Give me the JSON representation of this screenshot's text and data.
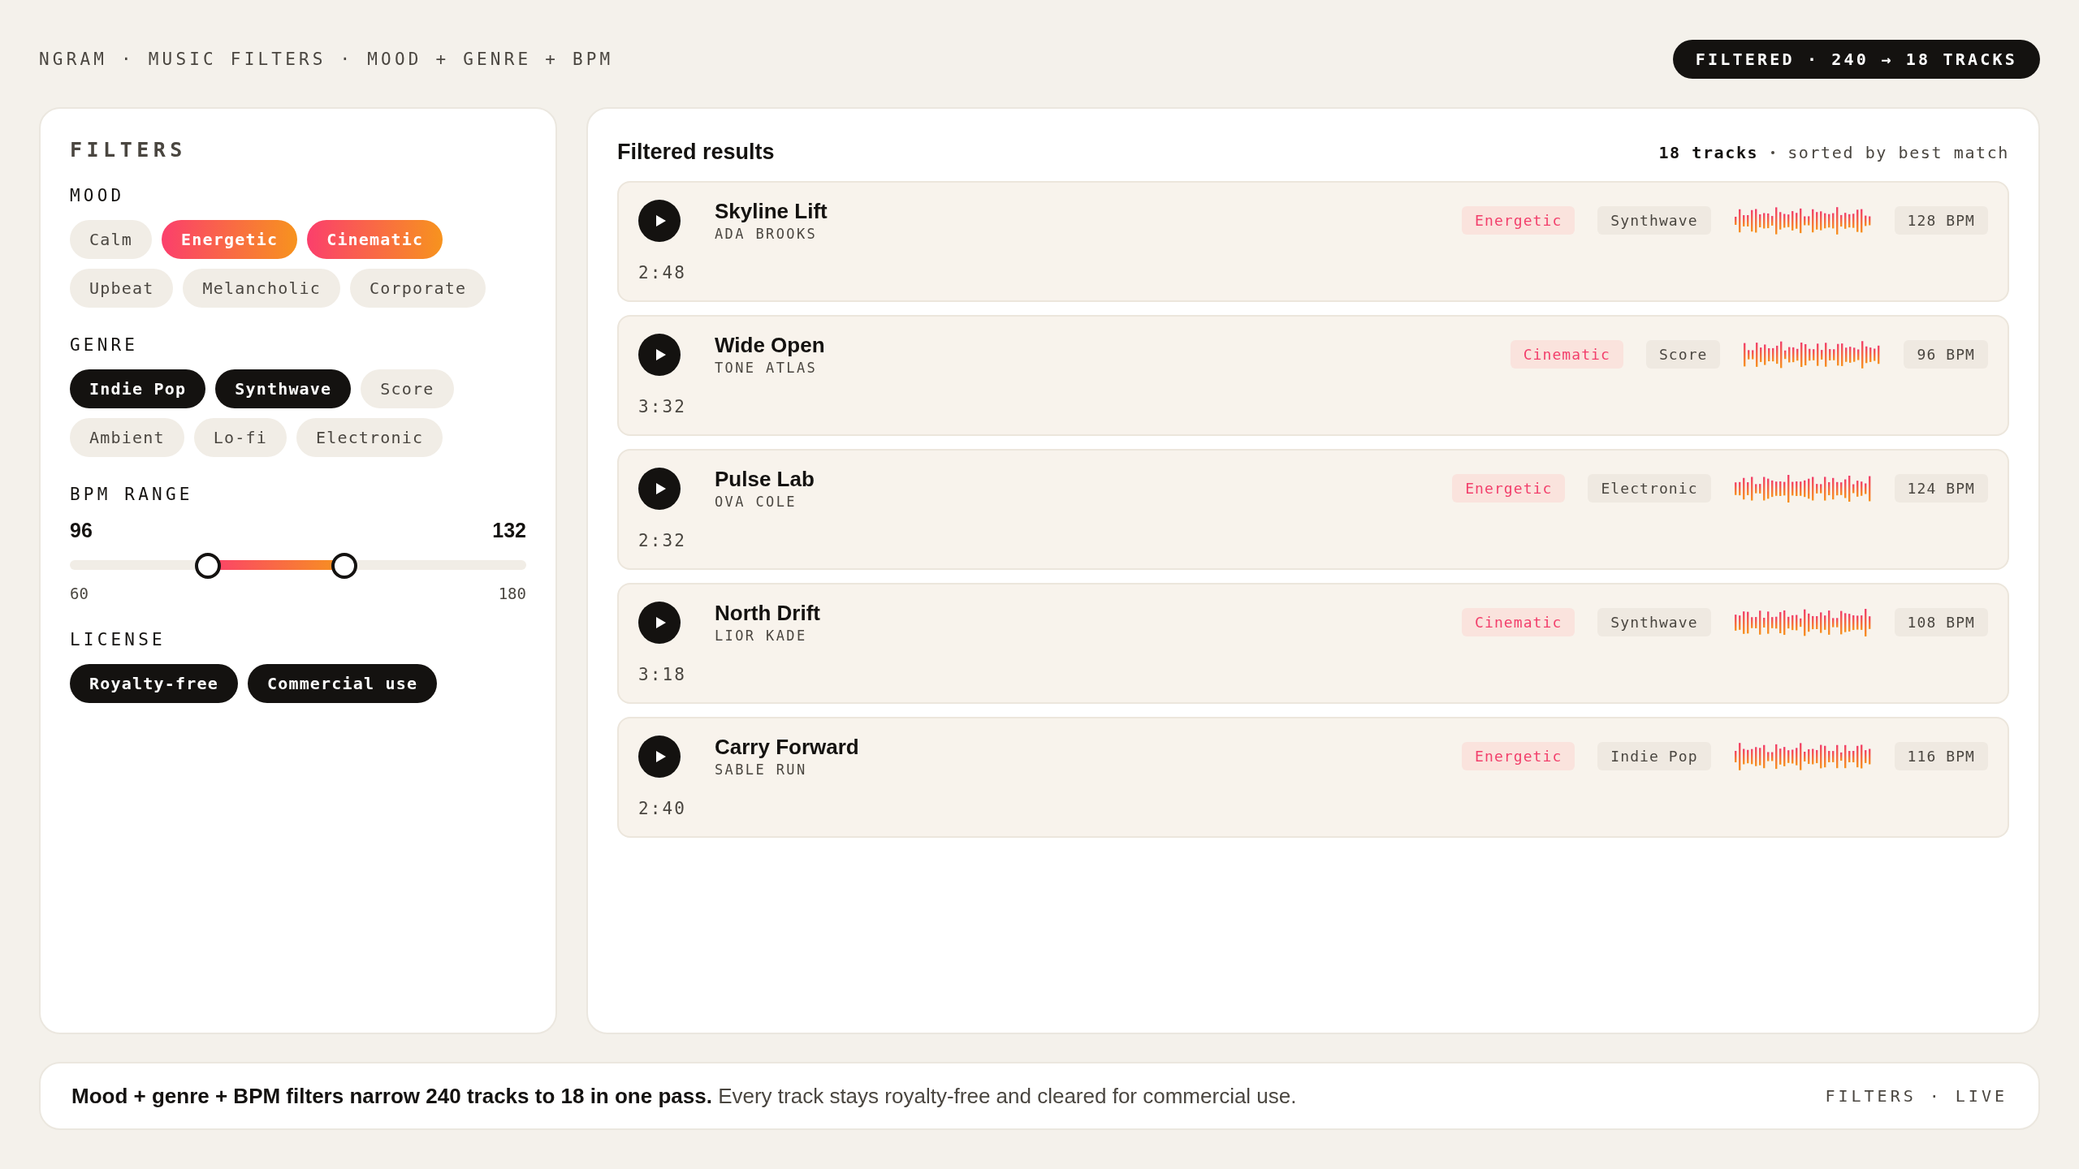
{
  "header": {
    "breadcrumb": "NGRAM · MUSIC FILTERS · MOOD + GENRE + BPM",
    "badge": "FILTERED · 240 → 18 TRACKS"
  },
  "filters": {
    "title": "FILTERS",
    "groups": [
      {
        "label": "MOOD",
        "kind": "gradient",
        "chips": [
          {
            "label": "Calm",
            "selected": false
          },
          {
            "label": "Energetic",
            "selected": true
          },
          {
            "label": "Cinematic",
            "selected": true
          },
          {
            "label": "Upbeat",
            "selected": false
          },
          {
            "label": "Melancholic",
            "selected": false
          },
          {
            "label": "Corporate",
            "selected": false
          }
        ]
      },
      {
        "label": "GENRE",
        "kind": "dark",
        "chips": [
          {
            "label": "Indie Pop",
            "selected": true
          },
          {
            "label": "Synthwave",
            "selected": true
          },
          {
            "label": "Score",
            "selected": false
          },
          {
            "label": "Ambient",
            "selected": false
          },
          {
            "label": "Lo-fi",
            "selected": false
          },
          {
            "label": "Electronic",
            "selected": false
          }
        ]
      }
    ],
    "bpm": {
      "label": "BPM RANGE",
      "low": {
        "value": "96",
        "level": 0.3
      },
      "high": {
        "value": "132",
        "level": 0.6
      },
      "min": "60",
      "max": "180"
    },
    "license": {
      "label": "LICENSE",
      "chips": [
        {
          "label": "Royalty-free",
          "selected": true
        },
        {
          "label": "Commercial use",
          "selected": true
        }
      ]
    }
  },
  "results": {
    "title": "Filtered results",
    "count": "18 tracks",
    "sort": "sorted by best match",
    "tracks": [
      {
        "title": "Skyline Lift",
        "artist": "ADA BROOKS",
        "duration": "2:48",
        "mood": "Energetic",
        "genre": "Synthwave",
        "bpm": "128 BPM"
      },
      {
        "title": "Wide Open",
        "artist": "TONE ATLAS",
        "duration": "3:32",
        "mood": "Cinematic",
        "genre": "Score",
        "bpm": "96 BPM"
      },
      {
        "title": "Pulse Lab",
        "artist": "OVA COLE",
        "duration": "2:32",
        "mood": "Energetic",
        "genre": "Electronic",
        "bpm": "124 BPM"
      },
      {
        "title": "North Drift",
        "artist": "LIOR KADE",
        "duration": "3:18",
        "mood": "Cinematic",
        "genre": "Synthwave",
        "bpm": "108 BPM"
      },
      {
        "title": "Carry Forward",
        "artist": "SABLE RUN",
        "duration": "2:40",
        "mood": "Energetic",
        "genre": "Indie Pop",
        "bpm": "116 BPM"
      }
    ]
  },
  "footer": {
    "text": "**Mood + genre + BPM filters narrow 240 tracks to 18 in one pass.** Every track stays royalty-free and cleared for commercial use.",
    "status": "FILTERS · LIVE"
  }
}
